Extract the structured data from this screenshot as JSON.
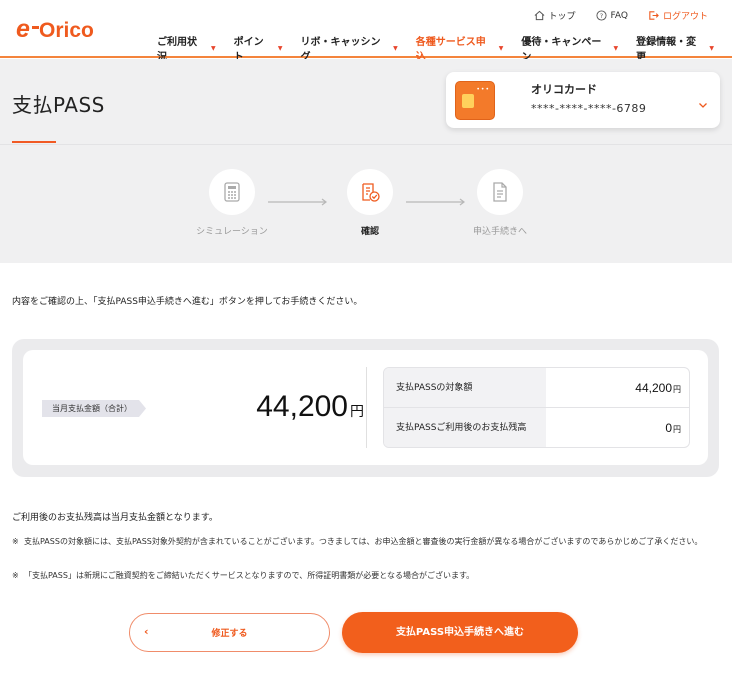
{
  "brand": {
    "logo_text": "e-Orico",
    "accent": "#ef5a1e"
  },
  "utility_nav": [
    {
      "label": "トップ",
      "icon": "home-icon"
    },
    {
      "label": "FAQ",
      "icon": "help-icon"
    },
    {
      "label": "ログアウト",
      "icon": "logout-icon"
    }
  ],
  "main_nav": [
    {
      "label": "ご利用状況",
      "active": false
    },
    {
      "label": "ポイント",
      "active": false
    },
    {
      "label": "リボ・キャッシング",
      "active": false
    },
    {
      "label": "各種サービス申込",
      "active": true
    },
    {
      "label": "優待・キャンペーン",
      "active": false
    },
    {
      "label": "登録情報・変更",
      "active": false
    }
  ],
  "page": {
    "title": "支払PASS"
  },
  "card": {
    "name": "オリコカード",
    "number": "****-****-****-6789"
  },
  "steps": [
    {
      "label": "シミュレーション",
      "icon": "calculator-icon",
      "current": false
    },
    {
      "label": "確認",
      "icon": "confirm-document-icon",
      "current": true
    },
    {
      "label": "申込手続きへ",
      "icon": "document-icon",
      "current": false
    }
  ],
  "intro_text": "内容をご確認の上、「支払PASS申込手続きへ進む」ボタンを押してお手続きください。",
  "summary": {
    "tag": "当月支払金額（合計）",
    "total_amount": "44,200",
    "total_unit": "円",
    "rows": [
      {
        "label": "支払PASSの対象額",
        "value": "44,200",
        "unit": "円"
      },
      {
        "label": "支払PASSご利用後のお支払残高",
        "value": "0",
        "unit": "円"
      }
    ]
  },
  "notes": {
    "main": "ご利用後のお支払残高は当月支払金額となります。",
    "items": [
      {
        "mark": "※",
        "text": "支払PASSの対象額には、支払PASS対象外契約が含まれていることがございます。つきましては、お申込金額と審査後の実行金額が異なる場合がございますのであらかじめご了承ください。"
      },
      {
        "mark": "※",
        "text": "「支払PASS」は新規にご融資契約をご締結いただくサービスとなりますので、所得証明書類が必要となる場合がございます。"
      }
    ]
  },
  "buttons": {
    "back_label": "修正する",
    "back_chevron": "‹",
    "next_label": "支払PASS申込手続きへ進む"
  }
}
